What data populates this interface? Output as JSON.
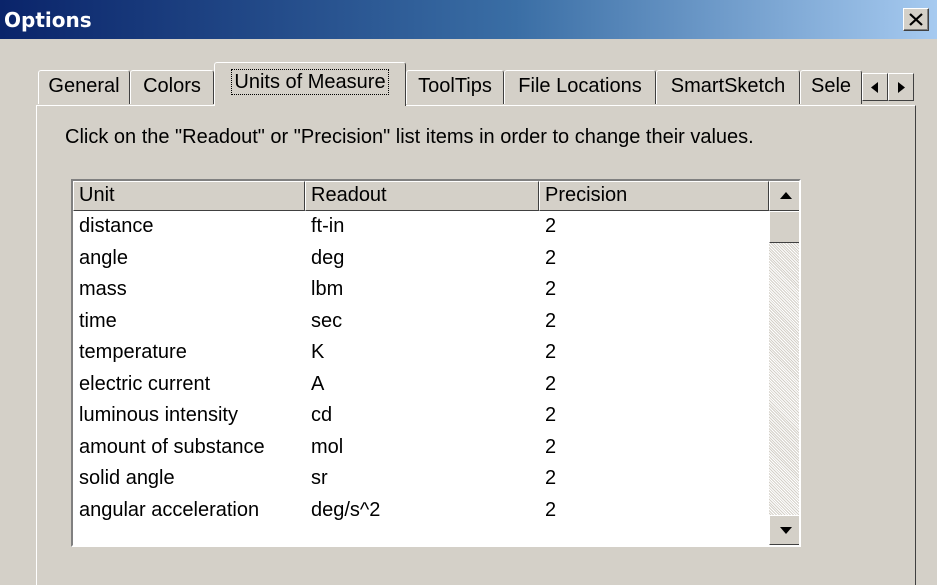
{
  "window": {
    "title": "Options",
    "close_icon": "close-icon"
  },
  "tabs": [
    {
      "label": "General",
      "active": false
    },
    {
      "label": "Colors",
      "active": false
    },
    {
      "label": "Units of Measure",
      "active": true
    },
    {
      "label": "ToolTips",
      "active": false
    },
    {
      "label": "File Locations",
      "active": false
    },
    {
      "label": "SmartSketch",
      "active": false
    },
    {
      "label": "Sele",
      "active": false
    }
  ],
  "tab_scroll": {
    "left_icon": "triangle-left-icon",
    "right_icon": "triangle-right-icon"
  },
  "panel": {
    "instructions": "Click on the \"Readout\" or \"Precision\" list items in order to change their values."
  },
  "table": {
    "columns": [
      "Unit",
      "Readout",
      "Precision"
    ],
    "rows": [
      {
        "unit": "distance",
        "readout": "ft-in",
        "precision": "2"
      },
      {
        "unit": "angle",
        "readout": "deg",
        "precision": "2"
      },
      {
        "unit": "mass",
        "readout": "lbm",
        "precision": "2"
      },
      {
        "unit": "time",
        "readout": "sec",
        "precision": "2"
      },
      {
        "unit": "temperature",
        "readout": "K",
        "precision": "2"
      },
      {
        "unit": "electric current",
        "readout": "A",
        "precision": "2"
      },
      {
        "unit": "luminous intensity",
        "readout": "cd",
        "precision": "2"
      },
      {
        "unit": "amount of substance",
        "readout": "mol",
        "precision": "2"
      },
      {
        "unit": "solid angle",
        "readout": "sr",
        "precision": "2"
      },
      {
        "unit": "angular acceleration",
        "readout": "deg/s^2",
        "precision": "2"
      }
    ]
  },
  "scrollbar": {
    "up_icon": "scroll-up-arrow-icon",
    "down_icon": "scroll-down-arrow-icon"
  }
}
